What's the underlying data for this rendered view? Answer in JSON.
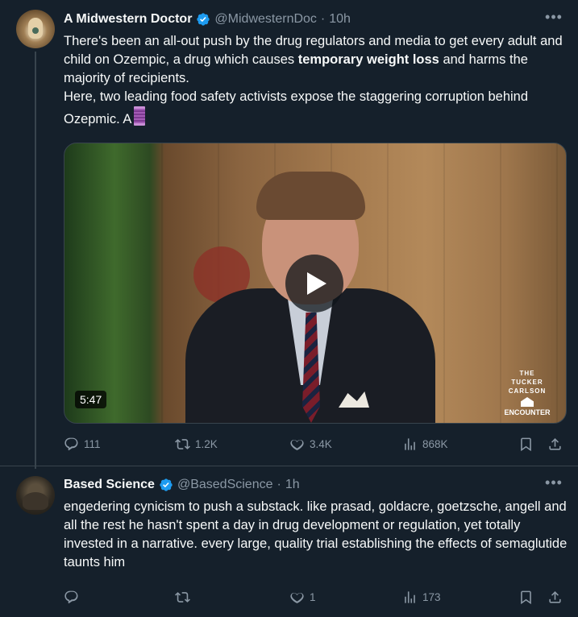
{
  "tweets": [
    {
      "display_name": "A Midwestern Doctor",
      "handle": "@MidwesternDoc",
      "separator": "·",
      "time": "10h",
      "more": "•••",
      "text_line1": "There's been an all-out push by the drug regulators and media to get every adult and child on Ozempic, a drug which causes ",
      "text_bold": "temporary weight loss",
      "text_line1_end": " and harms the majority of recipients.",
      "text_line2": "Here, two leading food safety activists expose the staggering corruption behind Ozepmic. A",
      "media": {
        "duration": "5:47",
        "brand_top": "THE",
        "brand_mid": "TUCKER CARLSON",
        "brand_bottom": "ENCOUNTER"
      },
      "replies": "111",
      "reposts": "1.2K",
      "likes": "3.4K",
      "views": "868K"
    },
    {
      "display_name": "Based Science",
      "handle": "@BasedScience",
      "separator": "·",
      "time": "1h",
      "more": "•••",
      "text": "engedering cynicism to push a substack. like prasad, goldacre, goetzsche, angell and all the rest he hasn't spent a day in drug development or regulation, yet totally invested in a narrative. every large, quality trial establishing the effects of semaglutide taunts him",
      "replies": "",
      "reposts": "",
      "likes": "1",
      "views": "173"
    }
  ],
  "colors": {
    "background": "#15202b",
    "text": "#f7f9f9",
    "muted": "#8b98a5",
    "verified": "#1d9bf0",
    "border": "#38444d"
  },
  "icons": [
    "verified-badge-icon",
    "more-icon",
    "reply-icon",
    "repost-icon",
    "like-icon",
    "views-icon",
    "bookmark-icon",
    "share-icon",
    "play-icon",
    "thread-emoji-icon"
  ]
}
